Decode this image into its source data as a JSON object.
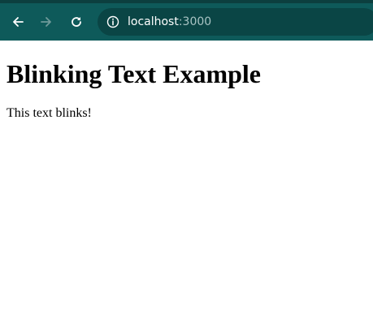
{
  "browser": {
    "toolbar_color": "#0e5a5a",
    "address_bar_color": "#0a4545",
    "back_icon": "arrow-left-icon",
    "forward_icon": "arrow-right-icon",
    "reload_icon": "reload-icon",
    "site_info_icon": "info-circle-icon",
    "url": {
      "host": "localhost",
      "port": ":3000"
    }
  },
  "page": {
    "heading": "Blinking Text Example",
    "paragraph": "This text blinks!"
  }
}
